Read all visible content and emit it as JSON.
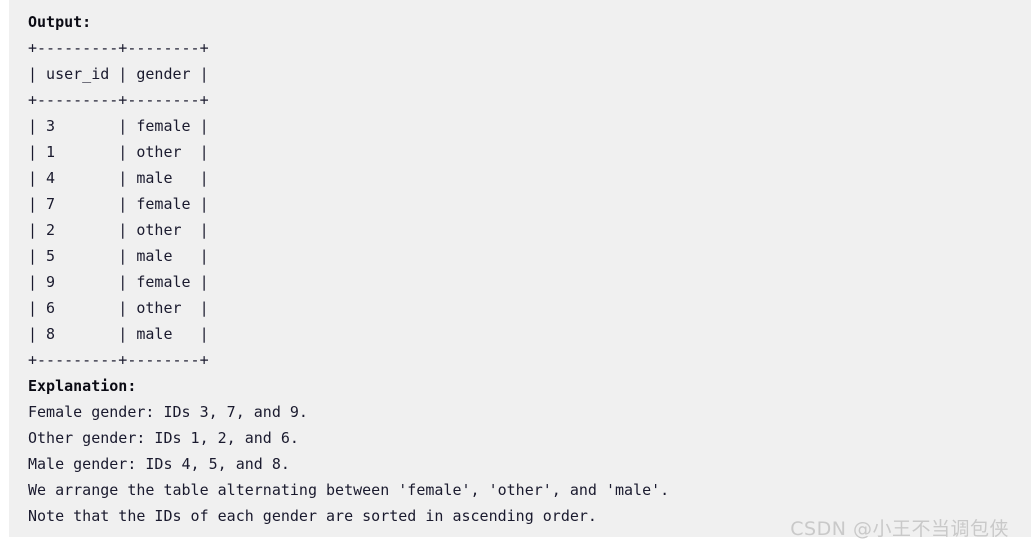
{
  "block": {
    "background_color": "#f0f0f0",
    "text_color": "#1a1a2e",
    "lines": [
      {
        "text": "Output:",
        "bold": true,
        "name": "output-heading"
      },
      {
        "text": "+---------+--------+",
        "bold": false,
        "name": "table-border-top"
      },
      {
        "text": "| user_id | gender |",
        "bold": false,
        "name": "table-header-row"
      },
      {
        "text": "+---------+--------+",
        "bold": false,
        "name": "table-border-header"
      },
      {
        "text": "| 3       | female |",
        "bold": false,
        "name": "table-row"
      },
      {
        "text": "| 1       | other  |",
        "bold": false,
        "name": "table-row"
      },
      {
        "text": "| 4       | male   |",
        "bold": false,
        "name": "table-row"
      },
      {
        "text": "| 7       | female |",
        "bold": false,
        "name": "table-row"
      },
      {
        "text": "| 2       | other  |",
        "bold": false,
        "name": "table-row"
      },
      {
        "text": "| 5       | male   |",
        "bold": false,
        "name": "table-row"
      },
      {
        "text": "| 9       | female |",
        "bold": false,
        "name": "table-row"
      },
      {
        "text": "| 6       | other  |",
        "bold": false,
        "name": "table-row"
      },
      {
        "text": "| 8       | male   |",
        "bold": false,
        "name": "table-row"
      },
      {
        "text": "+---------+--------+",
        "bold": false,
        "name": "table-border-bottom"
      },
      {
        "text": "Explanation:",
        "bold": true,
        "name": "explanation-heading"
      },
      {
        "text": "Female gender: IDs 3, 7, and 9.",
        "bold": false,
        "name": "explanation-line"
      },
      {
        "text": "Other gender: IDs 1, 2, and 6.",
        "bold": false,
        "name": "explanation-line"
      },
      {
        "text": "Male gender: IDs 4, 5, and 8.",
        "bold": false,
        "name": "explanation-line"
      },
      {
        "text": "We arrange the table alternating between 'female', 'other', and 'male'.",
        "bold": false,
        "name": "explanation-line"
      },
      {
        "text": "Note that the IDs of each gender are sorted in ascending order.",
        "bold": false,
        "name": "explanation-line"
      }
    ],
    "table": {
      "columns": [
        "user_id",
        "gender"
      ],
      "rows": [
        [
          "3",
          "female"
        ],
        [
          "1",
          "other"
        ],
        [
          "4",
          "male"
        ],
        [
          "7",
          "female"
        ],
        [
          "2",
          "other"
        ],
        [
          "5",
          "male"
        ],
        [
          "9",
          "female"
        ],
        [
          "6",
          "other"
        ],
        [
          "8",
          "male"
        ]
      ]
    }
  },
  "watermark": {
    "text": "CSDN @小王不当调包侠",
    "color": "#c9c9c9"
  }
}
